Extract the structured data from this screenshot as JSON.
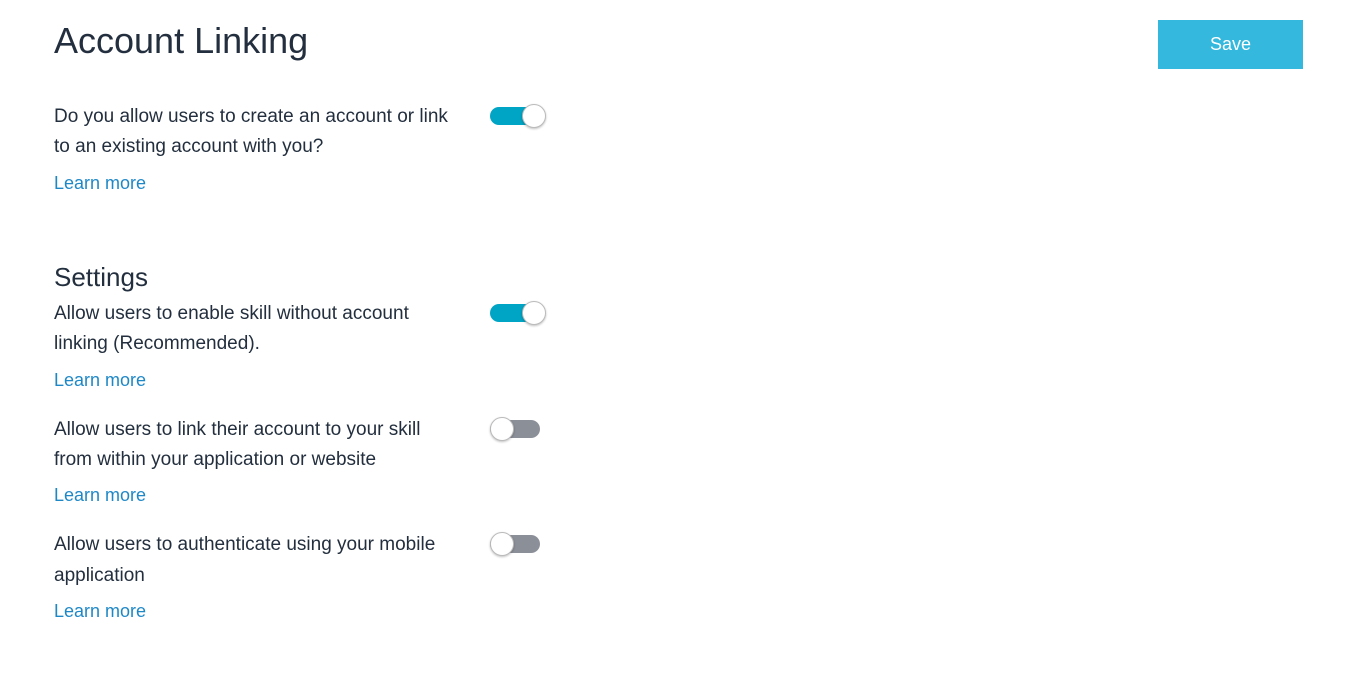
{
  "page": {
    "title": "Account Linking",
    "save_label": "Save"
  },
  "main_setting": {
    "label": "Do you allow users to create an account or link to an existing account with you?",
    "learn_more": "Learn more",
    "enabled": true
  },
  "settings": {
    "title": "Settings",
    "items": [
      {
        "label": "Allow users to enable skill without account linking (Recommended).",
        "learn_more": "Learn more",
        "enabled": true
      },
      {
        "label": "Allow users to link their account to your skill from within your application or website",
        "learn_more": "Learn more",
        "enabled": false
      },
      {
        "label": "Allow users to authenticate using your mobile application",
        "learn_more": "Learn more",
        "enabled": false
      }
    ]
  }
}
